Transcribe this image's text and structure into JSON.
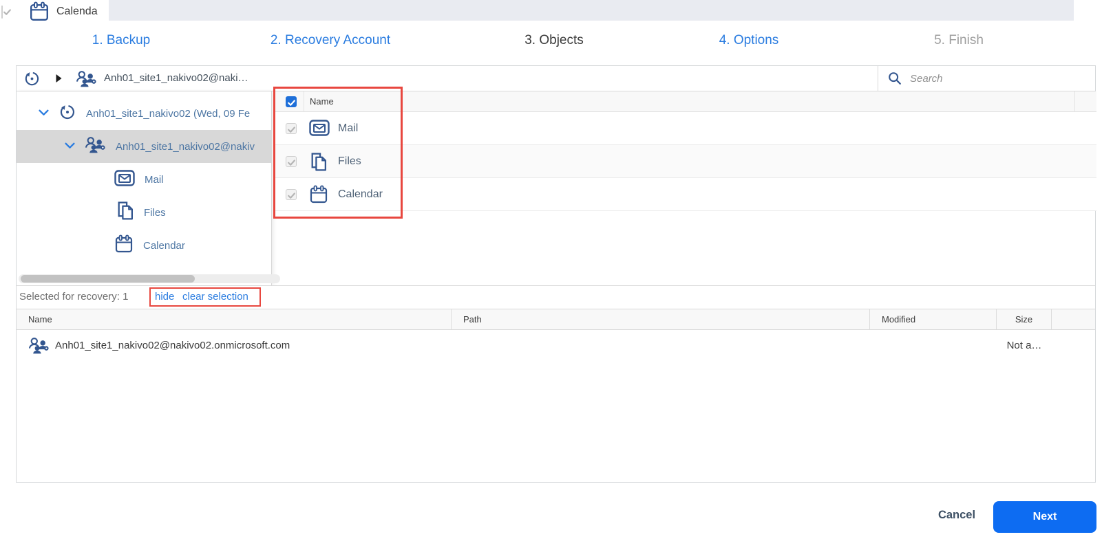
{
  "backdrop": {
    "item_label": "Calenda"
  },
  "wizard": {
    "steps": [
      {
        "label": "1. Backup"
      },
      {
        "label": "2. Recovery Account"
      },
      {
        "label": "3. Objects"
      },
      {
        "label": "4. Options"
      },
      {
        "label": "5. Finish"
      }
    ]
  },
  "toolbar": {
    "backup_title": "Anh01_site1_nakivo02@naki…",
    "search_placeholder": "Search"
  },
  "tree": {
    "recovery_point": "Anh01_site1_nakivo02 (Wed, 09 Fe",
    "account": "Anh01_site1_nakivo02@nakiv",
    "services": [
      "Mail",
      "Files",
      "Calendar"
    ]
  },
  "objects": {
    "name_header": "Name",
    "rows": [
      "Mail",
      "Files",
      "Calendar"
    ]
  },
  "selection": {
    "summary": "Selected for recovery: 1",
    "hide_link": "hide",
    "clear_link": "clear selection"
  },
  "results": {
    "columns": {
      "name": "Name",
      "path": "Path",
      "modified": "Modified",
      "size": "Size"
    },
    "row": {
      "name": "Anh01_site1_nakivo02@nakivo02.onmicrosoft.com",
      "size": "Not a…"
    }
  },
  "footer": {
    "cancel": "Cancel",
    "next": "Next"
  },
  "icons": {
    "restore-point-icon": "circular-arrow-with-dot",
    "account-group-icon": "users-with-gear",
    "mail-icon": "envelope-in-rounded-square",
    "files-icon": "stacked-documents",
    "calendar-icon": "calendar-grid",
    "search-icon": "magnifier",
    "chevron-down-icon": "v-chevron",
    "expander-icon": "right-triangle"
  },
  "colors": {
    "accent_blue": "#2a7ce0",
    "icon_blue": "#33568f",
    "annotation_red": "#e8473f",
    "next_button": "#0d6cf2",
    "selected_row": "#d8d8d8",
    "header_bg": "#f8f8f8"
  }
}
